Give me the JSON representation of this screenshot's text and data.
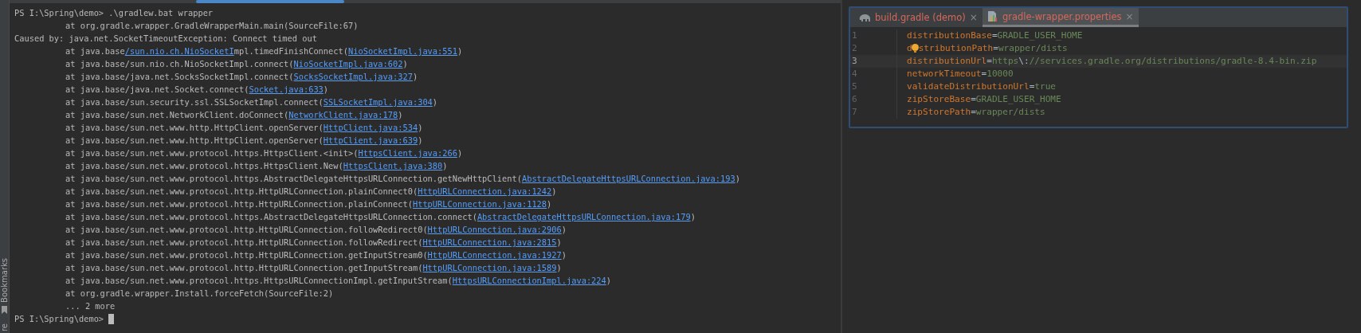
{
  "side_strip": {
    "label": "Bookmarks",
    "bottom_label": "re"
  },
  "terminal": {
    "lines": [
      {
        "kind": "prompt",
        "segments": [
          {
            "text": "PS I:\\Spring\\demo> .\\gradlew.bat wrapper",
            "link": false
          }
        ]
      },
      {
        "kind": "trace",
        "segments": [
          {
            "text": "at org.gradle.wrapper.GradleWrapperMain.main(SourceFile:67)",
            "link": false
          }
        ]
      },
      {
        "kind": "plain",
        "segments": [
          {
            "text": "Caused by: java.net.SocketTimeoutException: Connect timed out",
            "link": false
          }
        ]
      },
      {
        "kind": "trace",
        "segments": [
          {
            "text": "at java.base",
            "link": false
          },
          {
            "text": "/sun.nio.ch.NioSocketI",
            "link": true
          },
          {
            "text": "mpl.timedFinishConnect(",
            "link": false
          },
          {
            "text": "NioSocketImpl.java:551",
            "link": true
          },
          {
            "text": ")",
            "link": false
          }
        ]
      },
      {
        "kind": "trace",
        "segments": [
          {
            "text": "at java.base/sun.nio.ch.NioSocketImpl.connect(",
            "link": false
          },
          {
            "text": "NioSocketImpl.java:602",
            "link": true
          },
          {
            "text": ")",
            "link": false
          }
        ]
      },
      {
        "kind": "trace",
        "segments": [
          {
            "text": "at java.base/java.net.SocksSocketImpl.connect(",
            "link": false
          },
          {
            "text": "SocksSocketImpl.java:327",
            "link": true
          },
          {
            "text": ")",
            "link": false
          }
        ]
      },
      {
        "kind": "trace",
        "segments": [
          {
            "text": "at java.base/java.net.Socket.connect(",
            "link": false
          },
          {
            "text": "Socket.java:633",
            "link": true
          },
          {
            "text": ")",
            "link": false
          }
        ]
      },
      {
        "kind": "trace",
        "segments": [
          {
            "text": "at java.base/sun.security.ssl.SSLSocketImpl.connect(",
            "link": false
          },
          {
            "text": "SSLSocketImpl.java:304",
            "link": true
          },
          {
            "text": ")",
            "link": false
          }
        ]
      },
      {
        "kind": "trace",
        "segments": [
          {
            "text": "at java.base/sun.net.NetworkClient.doConnect(",
            "link": false
          },
          {
            "text": "NetworkClient.java:178",
            "link": true
          },
          {
            "text": ")",
            "link": false
          }
        ]
      },
      {
        "kind": "trace",
        "segments": [
          {
            "text": "at java.base/sun.net.www.http.HttpClient.openServer(",
            "link": false
          },
          {
            "text": "HttpClient.java:534",
            "link": true
          },
          {
            "text": ")",
            "link": false
          }
        ]
      },
      {
        "kind": "trace",
        "segments": [
          {
            "text": "at java.base/sun.net.www.http.HttpClient.openServer(",
            "link": false
          },
          {
            "text": "HttpClient.java:639",
            "link": true
          },
          {
            "text": ")",
            "link": false
          }
        ]
      },
      {
        "kind": "trace",
        "segments": [
          {
            "text": "at java.base/sun.net.www.protocol.https.HttpsClient.<init>(",
            "link": false
          },
          {
            "text": "HttpsClient.java:266",
            "link": true
          },
          {
            "text": ")",
            "link": false
          }
        ]
      },
      {
        "kind": "trace",
        "segments": [
          {
            "text": "at java.base/sun.net.www.protocol.https.HttpsClient.New(",
            "link": false
          },
          {
            "text": "HttpsClient.java:380",
            "link": true
          },
          {
            "text": ")",
            "link": false
          }
        ]
      },
      {
        "kind": "trace",
        "segments": [
          {
            "text": "at java.base/sun.net.www.protocol.https.AbstractDelegateHttpsURLConnection.getNewHttpClient(",
            "link": false
          },
          {
            "text": "AbstractDelegateHttpsURLConnection.java:193",
            "link": true
          },
          {
            "text": ")",
            "link": false
          }
        ]
      },
      {
        "kind": "trace",
        "segments": [
          {
            "text": "at java.base/sun.net.www.protocol.http.HttpURLConnection.plainConnect0(",
            "link": false
          },
          {
            "text": "HttpURLConnection.java:1242",
            "link": true
          },
          {
            "text": ")",
            "link": false
          }
        ]
      },
      {
        "kind": "trace",
        "segments": [
          {
            "text": "at java.base/sun.net.www.protocol.http.HttpURLConnection.plainConnect(",
            "link": false
          },
          {
            "text": "HttpURLConnection.java:1128",
            "link": true
          },
          {
            "text": ")",
            "link": false
          }
        ]
      },
      {
        "kind": "trace",
        "segments": [
          {
            "text": "at java.base/sun.net.www.protocol.https.AbstractDelegateHttpsURLConnection.connect(",
            "link": false
          },
          {
            "text": "AbstractDelegateHttpsURLConnection.java:179",
            "link": true
          },
          {
            "text": ")",
            "link": false
          }
        ]
      },
      {
        "kind": "trace",
        "segments": [
          {
            "text": "at java.base/sun.net.www.protocol.http.HttpURLConnection.followRedirect0(",
            "link": false
          },
          {
            "text": "HttpURLConnection.java:2906",
            "link": true
          },
          {
            "text": ")",
            "link": false
          }
        ]
      },
      {
        "kind": "trace",
        "segments": [
          {
            "text": "at java.base/sun.net.www.protocol.http.HttpURLConnection.followRedirect(",
            "link": false
          },
          {
            "text": "HttpURLConnection.java:2815",
            "link": true
          },
          {
            "text": ")",
            "link": false
          }
        ]
      },
      {
        "kind": "trace",
        "segments": [
          {
            "text": "at java.base/sun.net.www.protocol.http.HttpURLConnection.getInputStream0(",
            "link": false
          },
          {
            "text": "HttpURLConnection.java:1927",
            "link": true
          },
          {
            "text": ")",
            "link": false
          }
        ]
      },
      {
        "kind": "trace",
        "segments": [
          {
            "text": "at java.base/sun.net.www.protocol.http.HttpURLConnection.getInputStream(",
            "link": false
          },
          {
            "text": "HttpURLConnection.java:1589",
            "link": true
          },
          {
            "text": ")",
            "link": false
          }
        ]
      },
      {
        "kind": "trace",
        "segments": [
          {
            "text": "at java.base/sun.net.www.protocol.https.HttpsURLConnectionImpl.getInputStream(",
            "link": false
          },
          {
            "text": "HttpsURLConnectionImpl.java:224",
            "link": true
          },
          {
            "text": ")",
            "link": false
          }
        ]
      },
      {
        "kind": "trace",
        "segments": [
          {
            "text": "at org.gradle.wrapper.Install.forceFetch(SourceFile:2)",
            "link": false
          }
        ]
      },
      {
        "kind": "trace",
        "segments": [
          {
            "text": "... 2 more",
            "link": false
          }
        ]
      },
      {
        "kind": "prompt",
        "cursor": true,
        "segments": [
          {
            "text": "PS I:\\Spring\\demo>",
            "link": false
          }
        ]
      }
    ]
  },
  "editor": {
    "tabs": [
      {
        "label": "build.gradle (demo)",
        "kind": "gradle",
        "close": "×",
        "selected": false
      },
      {
        "label": "gradle-wrapper.properties",
        "kind": "properties",
        "close": "×",
        "selected": true
      }
    ],
    "lines": [
      {
        "number": "1",
        "key": "distributionBase",
        "sep": "=",
        "value": [
          {
            "text": "GRADLE_USER_HOME",
            "kind": "text"
          }
        ],
        "current": false,
        "bulb": false
      },
      {
        "number": "2",
        "key": "d",
        "key_rest": "stributionPath",
        "sep": "=",
        "value": [
          {
            "text": "wrapper/dists",
            "kind": "text"
          }
        ],
        "current": false,
        "bulb": true
      },
      {
        "number": "3",
        "key": "distributionUrl",
        "sep": "=",
        "value": [
          {
            "text": "https",
            "kind": "text"
          },
          {
            "text": "\\:",
            "kind": "escape"
          },
          {
            "text": "//services.gradle.org/distributions/gradle-8.4-bin.zip",
            "kind": "text"
          }
        ],
        "current": true,
        "bulb": false
      },
      {
        "number": "4",
        "key": "networkTimeout",
        "sep": "=",
        "value": [
          {
            "text": "10000",
            "kind": "text"
          }
        ],
        "current": false,
        "bulb": false
      },
      {
        "number": "5",
        "key": "validateDistributionUrl",
        "sep": "=",
        "value": [
          {
            "text": "true",
            "kind": "text"
          }
        ],
        "current": false,
        "bulb": false
      },
      {
        "number": "6",
        "key": "zipStoreBase",
        "sep": "=",
        "value": [
          {
            "text": "GRADLE_USER_HOME",
            "kind": "text"
          }
        ],
        "current": false,
        "bulb": false
      },
      {
        "number": "7",
        "key": "zipStorePath",
        "sep": "=",
        "value": [
          {
            "text": "wrapper/dists",
            "kind": "text"
          }
        ],
        "current": false,
        "bulb": false
      }
    ]
  }
}
